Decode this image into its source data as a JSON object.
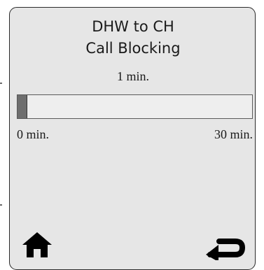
{
  "screen": {
    "title_line1": "DHW to CH",
    "title_line2": "Call Blocking"
  },
  "setting": {
    "current_value": "1 min.",
    "min_label": "0 min.",
    "max_label": "30 min.",
    "value": 1,
    "min": 0,
    "max": 30
  },
  "nav": {
    "home_icon": "home-icon",
    "back_icon": "return-arrow-icon"
  },
  "colors": {
    "screen_background": "#e6e6e6",
    "bar_fill": "#6e6e6e"
  }
}
